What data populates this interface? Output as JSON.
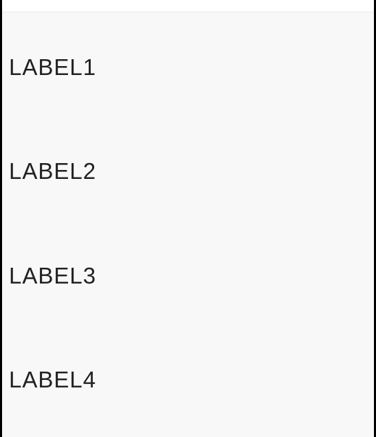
{
  "labels": {
    "0": "LABEL1",
    "1": "LABEL2",
    "2": "LABEL3",
    "3": "LABEL4"
  }
}
